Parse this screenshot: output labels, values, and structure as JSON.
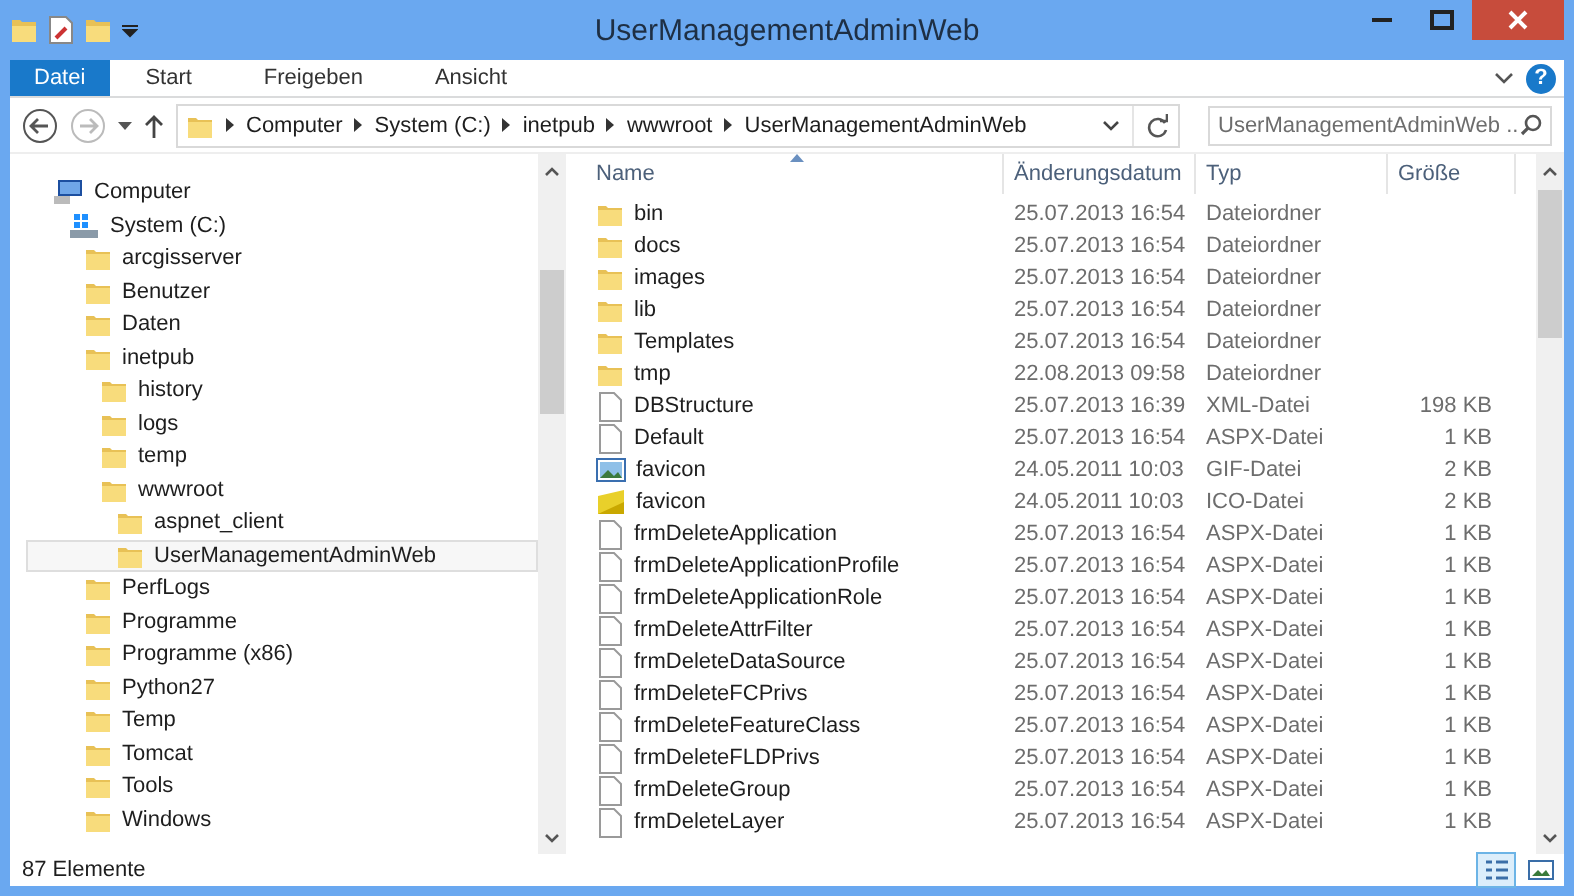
{
  "window": {
    "title": "UserManagementAdminWeb"
  },
  "ribbon": {
    "tabs": [
      {
        "label": "Datei",
        "kind": "file",
        "selected": false
      },
      {
        "label": "Start",
        "kind": "tab",
        "selected": false
      },
      {
        "label": "Freigeben",
        "kind": "tab",
        "selected": false
      },
      {
        "label": "Ansicht",
        "kind": "tab",
        "selected": false
      }
    ],
    "help": "?"
  },
  "address": {
    "path": [
      "Computer",
      "System (C:)",
      "inetpub",
      "wwwroot",
      "UserManagementAdminWeb"
    ],
    "search_placeholder": "UserManagementAdminWeb ..."
  },
  "tree": [
    {
      "label": "Computer",
      "kind": "computer",
      "selected": false,
      "children": [
        {
          "label": "System (C:)",
          "kind": "drive",
          "selected": false,
          "children": [
            {
              "label": "arcgisserver",
              "kind": "folder",
              "selected": false
            },
            {
              "label": "Benutzer",
              "kind": "folder",
              "selected": false
            },
            {
              "label": "Daten",
              "kind": "folder",
              "selected": false
            },
            {
              "label": "inetpub",
              "kind": "folder",
              "selected": false,
              "children": [
                {
                  "label": "history",
                  "kind": "folder",
                  "selected": false
                },
                {
                  "label": "logs",
                  "kind": "folder",
                  "selected": false
                },
                {
                  "label": "temp",
                  "kind": "folder",
                  "selected": false
                },
                {
                  "label": "wwwroot",
                  "kind": "folder",
                  "selected": false,
                  "children": [
                    {
                      "label": "aspnet_client",
                      "kind": "folder",
                      "selected": false
                    },
                    {
                      "label": "UserManagementAdminWeb",
                      "kind": "folder",
                      "selected": true
                    }
                  ]
                }
              ]
            },
            {
              "label": "PerfLogs",
              "kind": "folder",
              "selected": false
            },
            {
              "label": "Programme",
              "kind": "folder",
              "selected": false
            },
            {
              "label": "Programme (x86)",
              "kind": "folder",
              "selected": false
            },
            {
              "label": "Python27",
              "kind": "folder",
              "selected": false
            },
            {
              "label": "Temp",
              "kind": "folder",
              "selected": false
            },
            {
              "label": "Tomcat",
              "kind": "folder",
              "selected": false
            },
            {
              "label": "Tools",
              "kind": "folder",
              "selected": false
            },
            {
              "label": "Windows",
              "kind": "folder",
              "selected": false
            }
          ]
        }
      ]
    }
  ],
  "files": {
    "columns": [
      "Name",
      "Änderungsdatum",
      "Typ",
      "Größe"
    ],
    "rows": [
      {
        "name": "bin",
        "kind": "folder",
        "date": "25.07.2013 16:54",
        "type": "Dateiordner"
      },
      {
        "name": "docs",
        "kind": "folder",
        "date": "25.07.2013 16:54",
        "type": "Dateiordner"
      },
      {
        "name": "images",
        "kind": "folder",
        "date": "25.07.2013 16:54",
        "type": "Dateiordner"
      },
      {
        "name": "lib",
        "kind": "folder",
        "date": "25.07.2013 16:54",
        "type": "Dateiordner"
      },
      {
        "name": "Templates",
        "kind": "folder",
        "date": "25.07.2013 16:54",
        "type": "Dateiordner"
      },
      {
        "name": "tmp",
        "kind": "folder",
        "date": "22.08.2013 09:58",
        "type": "Dateiordner"
      },
      {
        "name": "DBStructure",
        "kind": "document",
        "date": "25.07.2013 16:39",
        "type": "XML-Datei",
        "size": "198 KB"
      },
      {
        "name": "Default",
        "kind": "document",
        "date": "25.07.2013 16:54",
        "type": "ASPX-Datei",
        "size": "1 KB"
      },
      {
        "name": "favicon",
        "kind": "image",
        "date": "24.05.2011 10:03",
        "type": "GIF-Datei",
        "size": "2 KB"
      },
      {
        "name": "favicon",
        "kind": "ico",
        "date": "24.05.2011 10:03",
        "type": "ICO-Datei",
        "size": "2 KB"
      },
      {
        "name": "frmDeleteApplication",
        "kind": "document",
        "date": "25.07.2013 16:54",
        "type": "ASPX-Datei",
        "size": "1 KB"
      },
      {
        "name": "frmDeleteApplicationProfile",
        "kind": "document",
        "date": "25.07.2013 16:54",
        "type": "ASPX-Datei",
        "size": "1 KB"
      },
      {
        "name": "frmDeleteApplicationRole",
        "kind": "document",
        "date": "25.07.2013 16:54",
        "type": "ASPX-Datei",
        "size": "1 KB"
      },
      {
        "name": "frmDeleteAttrFilter",
        "kind": "document",
        "date": "25.07.2013 16:54",
        "type": "ASPX-Datei",
        "size": "1 KB"
      },
      {
        "name": "frmDeleteDataSource",
        "kind": "document",
        "date": "25.07.2013 16:54",
        "type": "ASPX-Datei",
        "size": "1 KB"
      },
      {
        "name": "frmDeleteFCPrivs",
        "kind": "document",
        "date": "25.07.2013 16:54",
        "type": "ASPX-Datei",
        "size": "1 KB"
      },
      {
        "name": "frmDeleteFeatureClass",
        "kind": "document",
        "date": "25.07.2013 16:54",
        "type": "ASPX-Datei",
        "size": "1 KB"
      },
      {
        "name": "frmDeleteFLDPrivs",
        "kind": "document",
        "date": "25.07.2013 16:54",
        "type": "ASPX-Datei",
        "size": "1 KB"
      },
      {
        "name": "frmDeleteGroup",
        "kind": "document",
        "date": "25.07.2013 16:54",
        "type": "ASPX-Datei",
        "size": "1 KB"
      },
      {
        "name": "frmDeleteLayer",
        "kind": "document",
        "date": "25.07.2013 16:54",
        "type": "ASPX-Datei",
        "size": "1 KB"
      }
    ]
  },
  "status_bar": {
    "count": "87 Elemente",
    "views": [
      {
        "kind": "details",
        "selected": true
      },
      {
        "kind": "tiles",
        "selected": false
      }
    ]
  }
}
